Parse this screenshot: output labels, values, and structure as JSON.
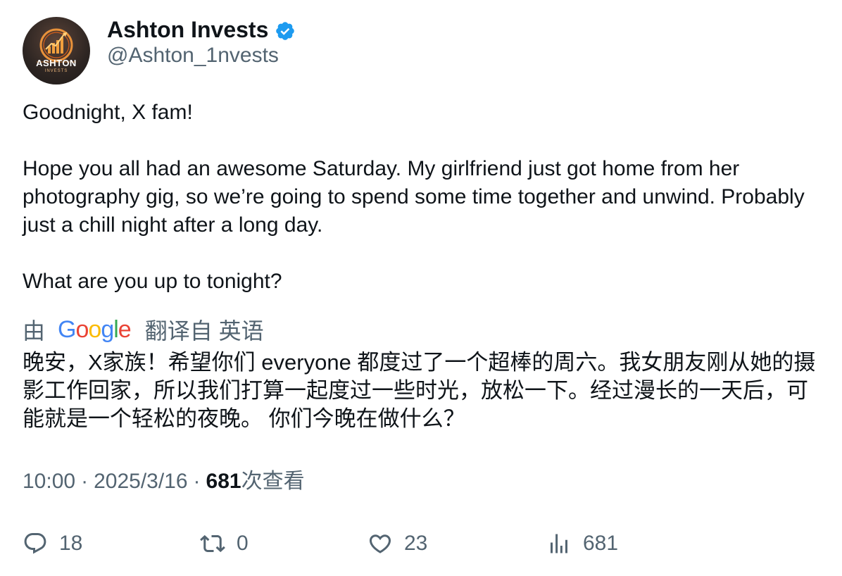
{
  "author": {
    "display_name": "Ashton Invests",
    "handle": "@Ashton_1nvests",
    "verified": true,
    "avatar_text": "ASHTON",
    "avatar_subtext": "INVESTS"
  },
  "tweet": {
    "paragraphs": [
      "Goodnight, X fam!",
      "Hope you all had an awesome Saturday. My girlfriend just got home from her photography gig, so we’re going to spend some time together and unwind. Probably just a chill night after a long day.",
      "What are you up to tonight?"
    ]
  },
  "translation": {
    "by_label": "由",
    "provider": "Google",
    "from_label": "翻译自 英语",
    "text": "晚安，X家族！希望你们 everyone 都度过了一个超棒的周六。我女朋友刚从她的摄影工作回家，所以我们打算一起度过一些时光，放松一下。经过漫长的一天后，可能就是一个轻松的夜晚。 你们今晚在做什么？"
  },
  "meta": {
    "time": "10:00",
    "date": "2025/3/16",
    "views_count": "681",
    "views_label": "次查看",
    "separator": "·"
  },
  "actions": {
    "replies": "18",
    "reposts": "0",
    "likes": "23",
    "views": "681"
  },
  "icons": {
    "verified": "verified-badge-icon",
    "reply": "reply-icon",
    "repost": "repost-icon",
    "like": "heart-icon",
    "views": "views-bar-chart-icon"
  },
  "colors": {
    "verified_blue": "#1d9bf0",
    "text_primary": "#0f1419",
    "text_secondary": "#536471"
  }
}
